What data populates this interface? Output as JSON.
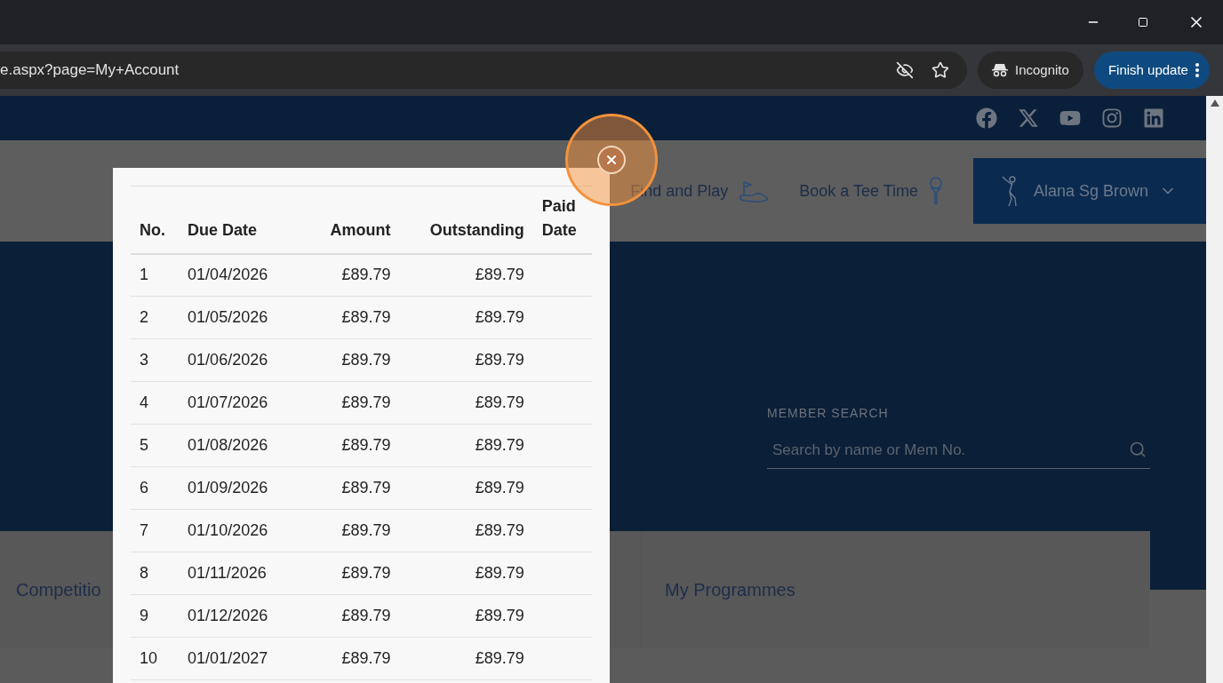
{
  "browser": {
    "url": "e.aspx?page=My+Account",
    "incognito_label": "Incognito",
    "update_button": "Finish update"
  },
  "nav": {
    "items": [
      "Find and Play",
      "Book a Tee Time"
    ],
    "user_name": "Alana Sg Brown"
  },
  "hero": {
    "search_label": "MEMBER SEARCH",
    "search_placeholder": "Search by name or Mem No."
  },
  "cards": [
    "Competitio",
    "My Programmes"
  ],
  "modal": {
    "columns": [
      "No.",
      "Due Date",
      "Amount",
      "Outstanding",
      "Paid Date"
    ],
    "rows": [
      {
        "no": "1",
        "due_date": "01/04/2026",
        "amount": "£89.79",
        "outstanding": "£89.79"
      },
      {
        "no": "2",
        "due_date": "01/05/2026",
        "amount": "£89.79",
        "outstanding": "£89.79"
      },
      {
        "no": "3",
        "due_date": "01/06/2026",
        "amount": "£89.79",
        "outstanding": "£89.79"
      },
      {
        "no": "4",
        "due_date": "01/07/2026",
        "amount": "£89.79",
        "outstanding": "£89.79"
      },
      {
        "no": "5",
        "due_date": "01/08/2026",
        "amount": "£89.79",
        "outstanding": "£89.79"
      },
      {
        "no": "6",
        "due_date": "01/09/2026",
        "amount": "£89.79",
        "outstanding": "£89.79"
      },
      {
        "no": "7",
        "due_date": "01/10/2026",
        "amount": "£89.79",
        "outstanding": "£89.79"
      },
      {
        "no": "8",
        "due_date": "01/11/2026",
        "amount": "£89.79",
        "outstanding": "£89.79"
      },
      {
        "no": "9",
        "due_date": "01/12/2026",
        "amount": "£89.79",
        "outstanding": "£89.79"
      },
      {
        "no": "10",
        "due_date": "01/01/2027",
        "amount": "£89.79",
        "outstanding": "£89.79"
      }
    ]
  }
}
